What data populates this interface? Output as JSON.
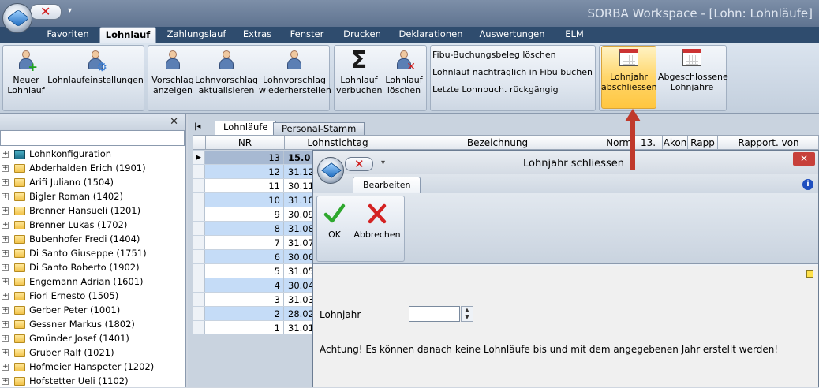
{
  "app_title": "SORBA Workspace - [Lohn: Lohnläufe]",
  "ribbon_tabs": [
    "Favoriten",
    "Lohnlauf",
    "Zahlungslauf",
    "Extras",
    "Fenster",
    "Drucken",
    "Deklarationen",
    "Auswertungen",
    "ELM"
  ],
  "ribbon_buttons": {
    "neuer_lohnlauf": [
      "Neuer",
      "Lohnlauf"
    ],
    "einstellungen": [
      "Lohnlaufeinstellungen",
      ""
    ],
    "vorschlag_anzeigen": [
      "Vorschlag",
      "anzeigen"
    ],
    "vorschlag_aktualisieren": [
      "Lohnvorschlag",
      "aktualisieren"
    ],
    "vorschlag_wiederherstellen": [
      "Lohnvorschlag",
      "wiederherstellen"
    ],
    "lohnlauf_verbuchen": [
      "Lohnlauf",
      "verbuchen"
    ],
    "lohnlauf_loeschen": [
      "Lohnlauf",
      "löschen"
    ],
    "jahr_abschliessen": [
      "Lohnjahr",
      "abschliessen"
    ],
    "abgeschlossene": [
      "Abgeschlossene",
      "Lohnjahre"
    ]
  },
  "text_links": [
    "Fibu-Buchungsbeleg löschen",
    "Lohnlauf nachträglich in Fibu buchen",
    "Letzte Lohnbuch. rückgängig"
  ],
  "tree": [
    "Lohnkonfiguration",
    "Abderhalden Erich (1901)",
    "Arifi Juliano (1504)",
    "Bigler Roman (1402)",
    "Brenner Hansueli (1201)",
    "Brenner Lukas (1702)",
    "Bubenhofer Fredi (1404)",
    "Di Santo Giuseppe (1751)",
    "Di Santo Roberto (1902)",
    "Engemann Adrian (1601)",
    "Fiori Ernesto (1505)",
    "Gerber Peter (1001)",
    "Gessner Markus (1802)",
    "Gmünder Josef (1401)",
    "Gruber Ralf (1021)",
    "Hofmeier Hanspeter (1202)",
    "Hofstetter Ueli (1102)"
  ],
  "grid_tabs": [
    "Lohnläufe",
    "Personal-Stamm"
  ],
  "grid_headers": [
    "NR",
    "Lohnstichtag",
    "Bezeichnung",
    "Norm",
    "13.",
    "Akon",
    "Rapp",
    "Rapport. von"
  ],
  "grid_rows": [
    {
      "nr": "13",
      "date": "15.0"
    },
    {
      "nr": "12",
      "date": "31.12"
    },
    {
      "nr": "11",
      "date": "30.11"
    },
    {
      "nr": "10",
      "date": "31.10"
    },
    {
      "nr": "9",
      "date": "30.09"
    },
    {
      "nr": "8",
      "date": "31.08"
    },
    {
      "nr": "7",
      "date": "31.07"
    },
    {
      "nr": "6",
      "date": "30.06"
    },
    {
      "nr": "5",
      "date": "31.05"
    },
    {
      "nr": "4",
      "date": "30.04"
    },
    {
      "nr": "3",
      "date": "31.03"
    },
    {
      "nr": "2",
      "date": "28.02"
    },
    {
      "nr": "1",
      "date": "31.01"
    }
  ],
  "dialog": {
    "title": "Lohnjahr schliessen",
    "tab": "Bearbeiten",
    "ok_label": "OK",
    "cancel_label": "Abbrechen",
    "year_label": "Lohnjahr",
    "year_value": "",
    "warning": "Achtung! Es können danach keine Lohnläufe bis und mit dem angegebenen Jahr erstellt werden!"
  },
  "colors": {
    "accent_red": "#c0392b",
    "selection_blue": "#c5dcf7",
    "highlight": "#ffd66b"
  }
}
